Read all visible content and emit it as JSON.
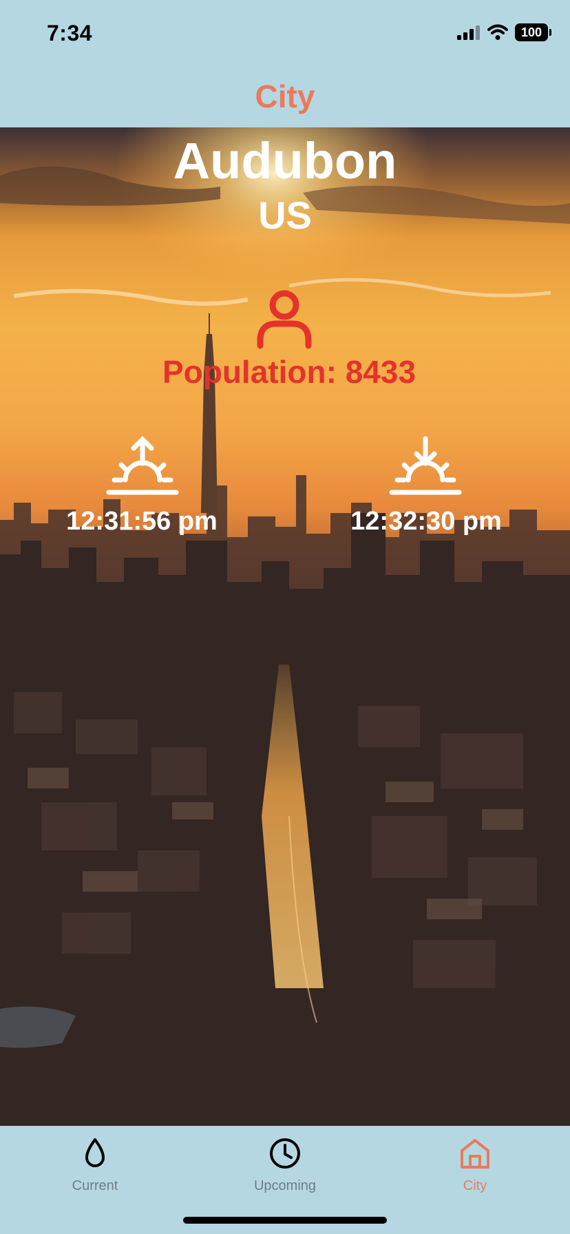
{
  "status_bar": {
    "time": "7:34",
    "battery": "100",
    "icons": [
      "signal-icon",
      "wifi-icon",
      "battery-icon"
    ]
  },
  "nav": {
    "title": "City"
  },
  "city": {
    "name": "Audubon",
    "country": "US",
    "population_label": "Population: 8433",
    "sunrise": "12:31:56 pm",
    "sunset": "12:32:30 pm"
  },
  "colors": {
    "accent": "#ea7a5c",
    "population": "#e4332a",
    "bar_background": "#b5d7e2",
    "inactive_tab": "#6f7d86"
  },
  "tabs": [
    {
      "label": "Current",
      "icon": "drop-icon",
      "active": false
    },
    {
      "label": "Upcoming",
      "icon": "clock-icon",
      "active": false
    },
    {
      "label": "City",
      "icon": "home-icon",
      "active": true
    }
  ]
}
